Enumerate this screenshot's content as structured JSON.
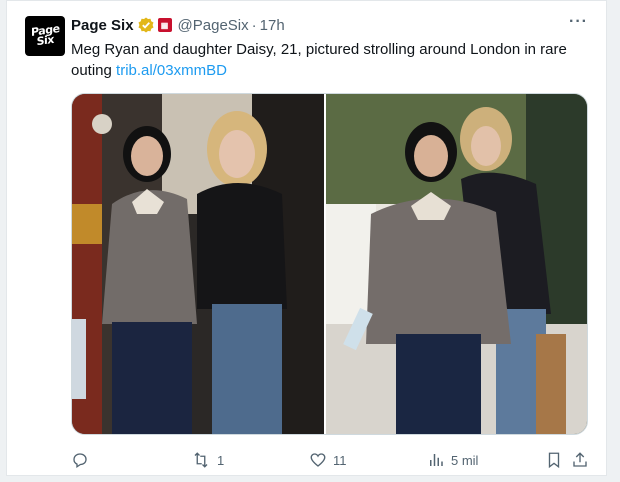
{
  "post": {
    "author_name": "Page Six",
    "avatar_text_line1": "Page",
    "avatar_text_line2": "Six",
    "handle": "@PageSix",
    "separator": "·",
    "time": "17h",
    "more": "···",
    "text": "Meg Ryan and daughter Daisy, 21, pictured strolling around London in rare outing ",
    "link": "trib.al/03xmmBD"
  },
  "actions": {
    "reply_count": "",
    "retweet_count": "1",
    "like_count": "11",
    "views_count": "5 mil"
  },
  "colors": {
    "link": "#1d9bf0",
    "verified": "#e2b719",
    "affiliate": "#c8102e",
    "muted": "#536471"
  },
  "icons": [
    "verified-badge-icon",
    "affiliate-badge-icon",
    "more-icon",
    "reply-icon",
    "retweet-icon",
    "like-icon",
    "views-icon",
    "bookmark-icon",
    "share-icon"
  ]
}
